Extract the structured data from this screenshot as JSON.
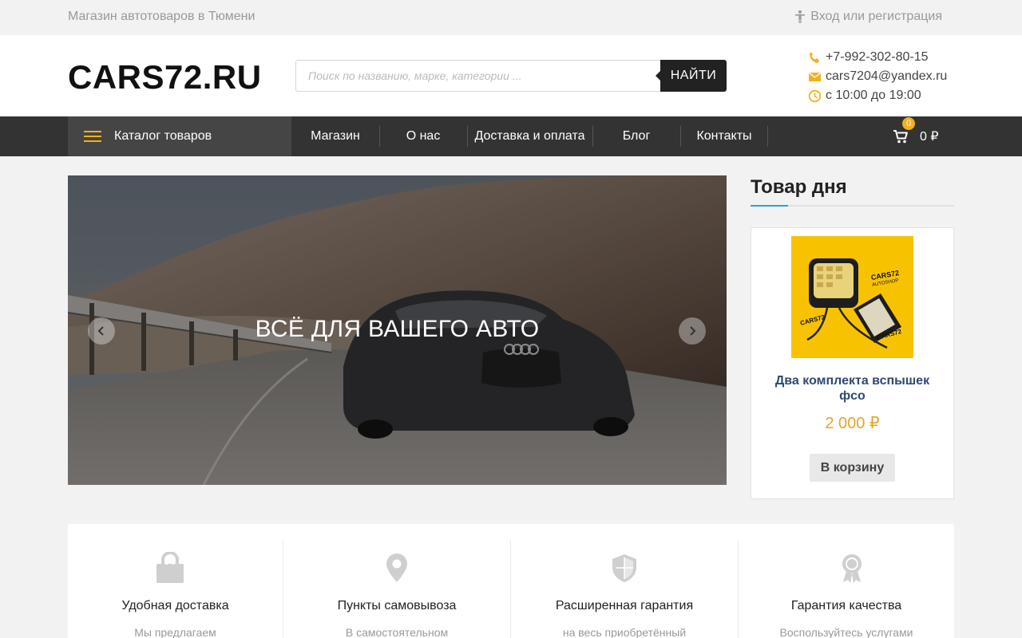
{
  "topbar": {
    "tagline": "Магазин автотоваров в Тюмени",
    "login": "Вход или регистрация"
  },
  "header": {
    "logo": "CARS72.RU",
    "search": {
      "placeholder": "Поиск по названию, марке, категории ...",
      "button": "НАЙТИ"
    },
    "contacts": {
      "phone": "+7-992-302-80-15",
      "email": "cars7204@yandex.ru",
      "hours": "с 10:00 до 19:00"
    }
  },
  "nav": {
    "catalog": "Каталог товаров",
    "items": [
      "Магазин",
      "О нас",
      "Доставка и оплата",
      "Блог",
      "Контакты"
    ],
    "cart": {
      "count": "0",
      "total": "0 ₽"
    }
  },
  "hero": {
    "caption": "ВСЁ ДЛЯ ВАШЕГО АВТО"
  },
  "product_of_day": {
    "title": "Товар дня",
    "name": "Два комплекта вспышек фсо",
    "price": "2 000 ₽",
    "button": "В корзину",
    "image_brand": "CARS72 AUTOSHOP"
  },
  "features": [
    {
      "icon": "bag-icon",
      "title": "Удобная доставка",
      "text": "Мы предлагаем"
    },
    {
      "icon": "location-pin-icon",
      "title": "Пункты самовывоза",
      "text": "В самостоятельном"
    },
    {
      "icon": "shield-icon",
      "title": "Расширенная гарантия",
      "text": "на весь приобретённый"
    },
    {
      "icon": "award-icon",
      "title": "Гарантия качества",
      "text": "Воспользуйтесь услугами"
    }
  ],
  "colors": {
    "accent_yellow": "#f2b01e",
    "nav_bg": "#333333",
    "catalog_bg": "#454545",
    "link_blue": "#2b4a75",
    "price_orange": "#e7a32a",
    "underline_blue": "#27a3dd"
  }
}
